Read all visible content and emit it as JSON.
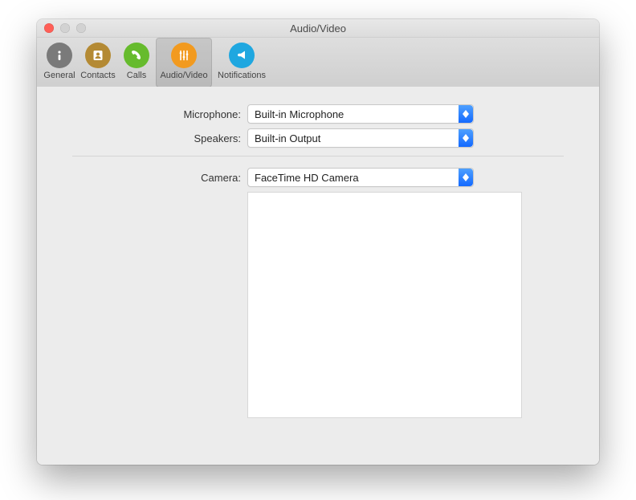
{
  "window": {
    "title": "Audio/Video"
  },
  "toolbar": {
    "items": [
      {
        "label": "General"
      },
      {
        "label": "Contacts"
      },
      {
        "label": "Calls"
      },
      {
        "label": "Audio/Video"
      },
      {
        "label": "Notifications"
      }
    ]
  },
  "form": {
    "microphone": {
      "label": "Microphone:",
      "value": "Built-in Microphone"
    },
    "speakers": {
      "label": "Speakers:",
      "value": "Built-in Output"
    },
    "camera": {
      "label": "Camera:",
      "value": "FaceTime HD Camera"
    }
  }
}
